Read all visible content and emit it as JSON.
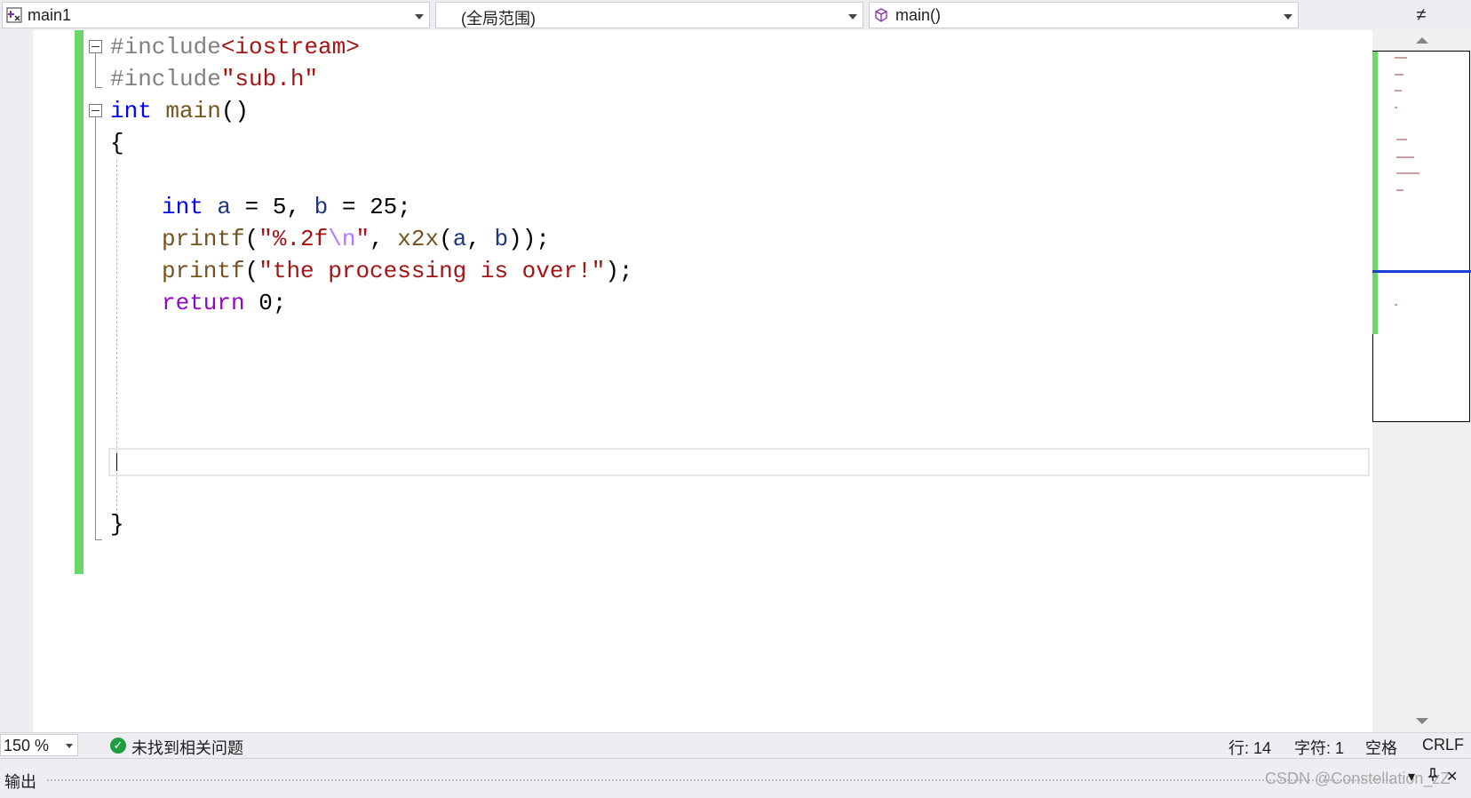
{
  "navbar": {
    "project": {
      "label": "main1",
      "icon": "project-icon"
    },
    "scope": {
      "label": "(全局范围)"
    },
    "member": {
      "label": "main()",
      "icon": "function-cube-icon"
    },
    "split_icon": "split-window-icon",
    "split_glyph": "≠"
  },
  "code": {
    "lines": [
      {
        "parts": [
          "#include",
          "<iostream>"
        ]
      },
      {
        "parts": [
          "#include",
          "\"sub.h\""
        ]
      },
      {
        "parts": [
          "int",
          " main",
          "()"
        ]
      },
      {
        "parts": [
          "{"
        ]
      },
      {
        "parts": [
          ""
        ]
      },
      {
        "parts": [
          "int",
          " a",
          " = 5, ",
          "b",
          " = 25;"
        ]
      },
      {
        "parts": [
          "printf",
          "(",
          "\"%.2f",
          "\\n",
          "\"",
          ", ",
          "x2x",
          "(",
          "a",
          ", ",
          "b",
          "));"
        ]
      },
      {
        "parts": [
          "printf",
          "(",
          "\"the processing is over!\"",
          ");"
        ]
      },
      {
        "parts": [
          "return",
          " 0;"
        ]
      },
      {
        "parts": [
          "}"
        ]
      }
    ]
  },
  "colors": {
    "keyword": "#0000ff",
    "control_keyword": "#8f08c4",
    "string": "#a31515",
    "preprocessor": "#808080",
    "function": "#74531f",
    "variable": "#1f377f",
    "escape": "#b776fb",
    "change_bar": "#6ad96a",
    "minimap_position": "#1a3ed6",
    "ok": "#1e9d41"
  },
  "status": {
    "zoom": "150 %",
    "issues_icon": "check-circle-icon",
    "issues": "未找到相关问题",
    "line": "行: 14",
    "char": "字符: 1",
    "whitespace": "空格",
    "line_ending": "CRLF"
  },
  "output": {
    "title": "输出",
    "dropdown_icon": "dropdown-icon",
    "pin_icon": "pin-icon",
    "close_icon": "close-icon",
    "watermark": "CSDN @Constellation_zZ"
  }
}
